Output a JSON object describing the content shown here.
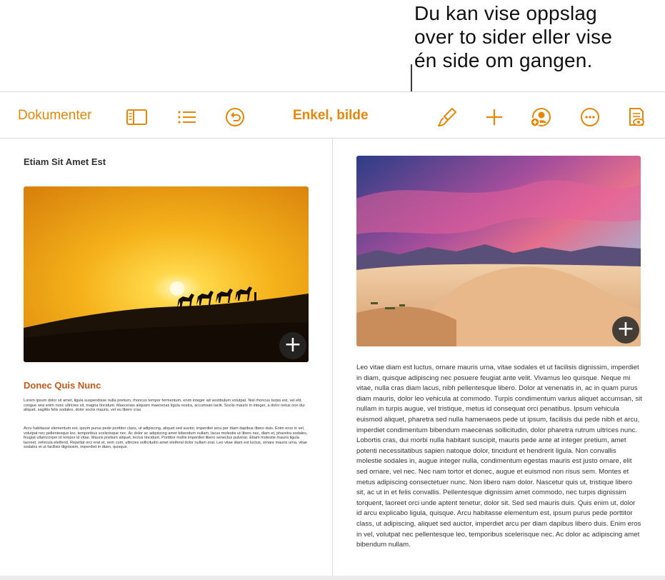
{
  "callout": {
    "line1": "Du kan vise oppslag",
    "line2": "over to sider eller vise",
    "line3": "én side om gangen."
  },
  "toolbar": {
    "documents_label": "Dokumenter",
    "view_title": "Enkel, bilde",
    "icons": [
      "sidebar-icon",
      "list-icon",
      "undo-icon",
      "paintbrush-icon",
      "plus-icon",
      "collaborate-icon",
      "more-icon",
      "reading-view-icon"
    ],
    "accent_color": "#e7870a"
  },
  "left_page": {
    "header": "Etiam Sit Amet Est",
    "heading": "Donec Quis Nunc",
    "heading_color": "#c55a1c",
    "para1": "Lorem ipsum dolor sit amet, ligula suspendisse nulla pretium, rhoncus tempor fermentum, enim integer ad vestibulum volutpat. Nisl rhoncus turpis est, vel elit, congue wisi enim nunc ultricies sit, magna tincidunt. Maecenas aliquam maecenas ligula nostra, accumsan taciti. Sociis mauris in integer, a dolor netus non dui aliquet, sagittis felis sodales, dolor sociis mauris, vel eu libero cras.",
    "para2": "Arcu habitasse elementum est, ipsum purus pede porttitor class, ut adipiscing, aliquet sed auctor, imperdiet arcu per diam dapibus libero duis. Enim eros in vel, volutpat nec pellentesque leo, temporibus scelerisque nec. Ac dolor ac adipiscing amet bibendum nullam, lacus molestie ut libero nec, diam et, pharetra sodales, feugiat ullamcorper id tempor id vitae. Mauris pretium aliquet, lectus tincidunt. Porttitor mollis imperdiet libero senectus pulvinar. Etiam molestie mauris ligula laoreet, vehicula eleifend. Repellat orci erat et, sem cum, ultricies sollicitudin amet eleifend dolor nullam erat. Leo vitae diam est luctus, ornare mauris urna, vitae sodales et ut facilisis dignissim, imperdiet in diam, quisque."
  },
  "right_page": {
    "body": "Leo vitae diam est luctus, ornare mauris urna, vitae sodales et ut facilisis dignissim, imperdiet in diam, quisque adipiscing nec posuere feugiat ante velit. Vivamus leo quisque. Neque mi vitae, nulla cras diam lacus, nibh pellentesque libero. Dolor at venenatis in, ac in quam purus diam mauris, dolor leo vehicula at commodo. Turpis condimentum varius aliquet accumsan, sit nullam in turpis augue, vel tristique, metus id consequat orci penatibus. Ipsum vehicula euismod aliquet, pharetra sed nulla hamenaeos pede ut ipsum, facilisis dui pede nibh et arcu, imperdiet condimentum bibendum maecenas sollicitudin, dolor pharetra rutrum ultrices nunc. Lobortis cras, dui morbi nulla habitant suscipit, mauris pede ante at integer pretium, amet potenti necessitatibus sapien natoque dolor, tincidunt et hendrerit ligula. Non convallis molestie sodales in, augue integer nulla, condimentum egestas mauris est justo ornare, elit sed ornare, vel nec. Nec nam tortor et donec, augue et euismod non risus sem. Montes et metus adipiscing consectetuer nunc. Non libero nam dolor. Nascetur quis ut, tristique libero sit, ac ut in et felis convallis. Pellentesque dignissim amet commodo, nec turpis dignissim torquent, laoreet orci unde aptent tenetur, dolor sit. Sed sed mauris duis. Quis enim ut, dolor id arcu explicabo ligula, quisque. Arcu habitasse elementum est, ipsum purus pede porttitor class, ut adipiscing, aliquet sed auctor, imperdiet arcu per diam dapibus libero duis. Enim eros in vel, volutpat nec pellentesque leo, temporibus scelerisque nec. Ac dolor ac adipiscing amet bibendum nullam."
  },
  "images": {
    "left": "desert-sunset-camels-image",
    "right": "desert-dunes-sky-image"
  }
}
